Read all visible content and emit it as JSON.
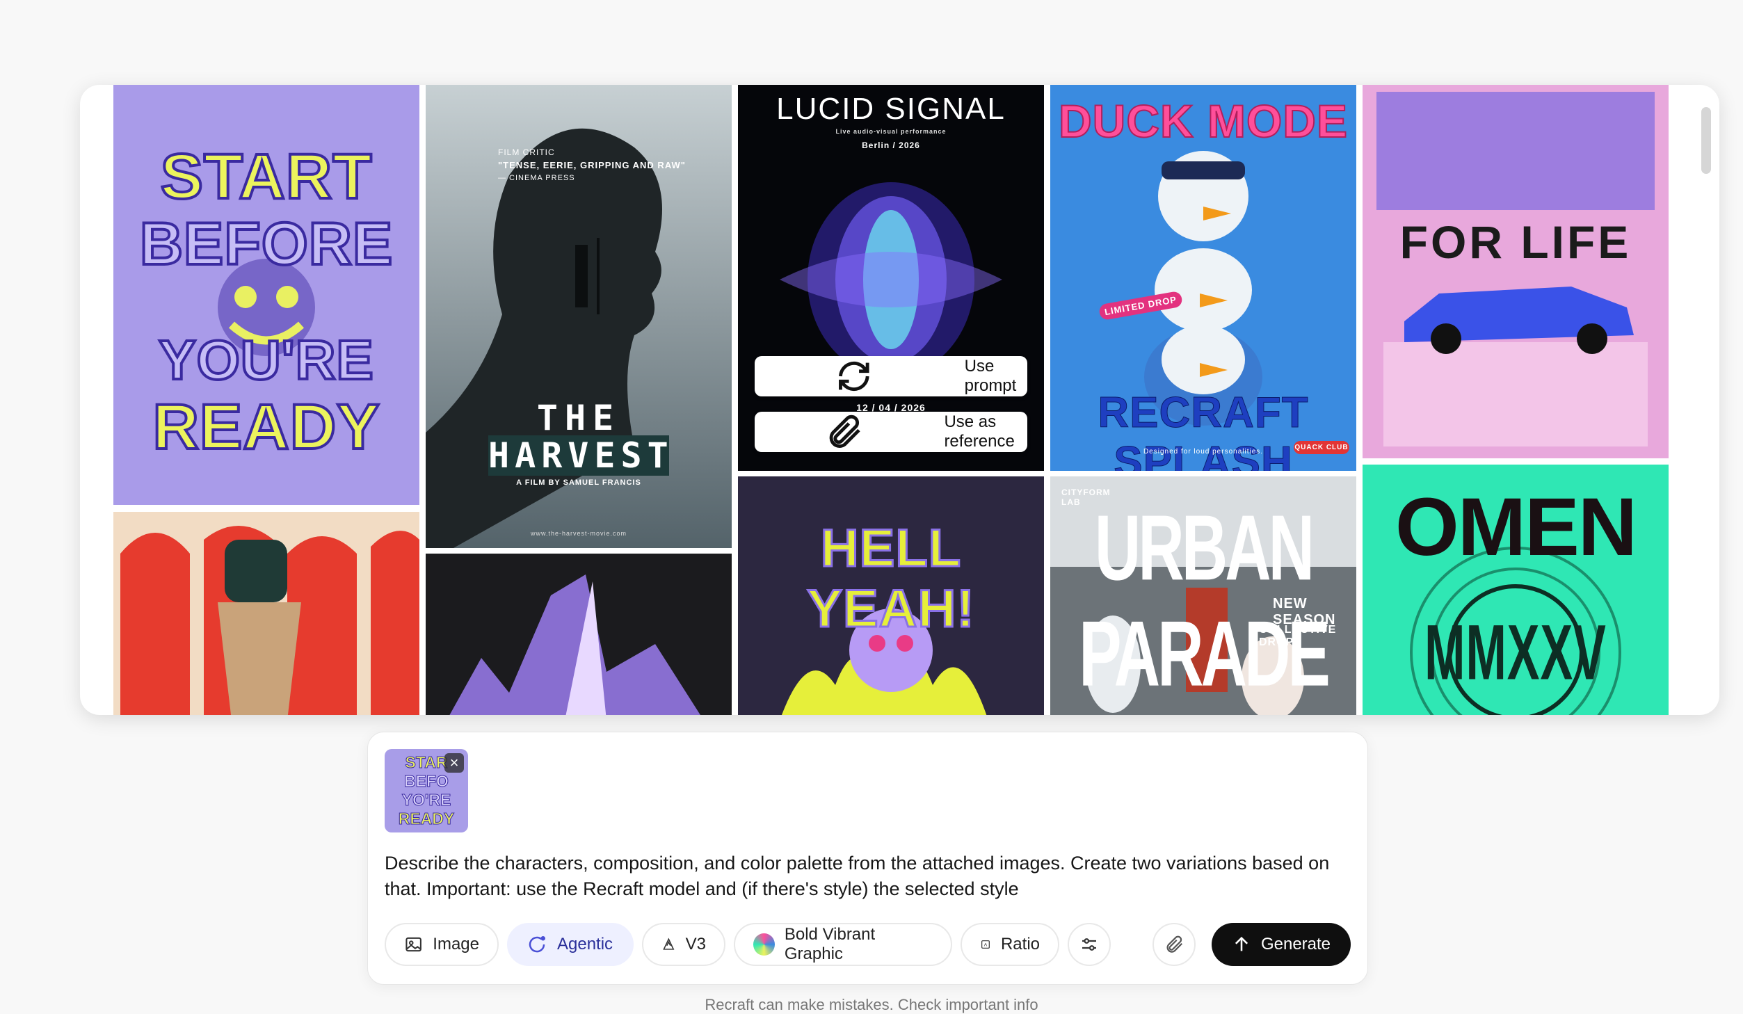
{
  "overlay": {
    "use_prompt": "Use prompt",
    "use_as_reference": "Use as reference"
  },
  "tiles": {
    "start": {
      "lines": [
        "START",
        "BEFORE",
        "YOU'RE",
        "READY"
      ]
    },
    "harvest": {
      "critic_label": "FILM CRITIC",
      "quote": "\"TENSE, EERIE, GRIPPING AND RAW\"",
      "quote_source": "— CINEMA PRESS",
      "title_1": "THE",
      "title_2": "HARVEST",
      "byline": "A FILM BY SAMUEL FRANCIS",
      "url": "www.the-harvest-movie.com"
    },
    "lucid": {
      "title": "LUCID SIGNAL",
      "subtitle": "Live audio-visual performance",
      "city": "Berlin / 2026",
      "date": "12 / 04 / 2026"
    },
    "duck": {
      "title": "DUCK MODE",
      "badge": "LIMITED DROP",
      "bottom": "RECRAFT SPLASH",
      "tagline": "Designed for loud personalities.",
      "club": "QUACK CLUB"
    },
    "forlife": {
      "title": "FOR LIFE"
    },
    "hell": {
      "title": "HELL YEAH!"
    },
    "urban": {
      "label": "CITYFORM LAB",
      "title": "URBAN PARADE",
      "season": "NEW SEASON",
      "drop": "COLLECTIVE DROP"
    },
    "omen": {
      "title": "OMEN",
      "numeral": "MMXXV"
    }
  },
  "attachment": {
    "lines": [
      "STAR",
      "BEFO",
      "YO'RE",
      "READY"
    ]
  },
  "prompt": "Describe the characters, composition, and color palette from the attached images. Create two variations based on that. Important: use the Recraft model and (if there's style) the selected style",
  "toolbar": {
    "image": "Image",
    "agentic": "Agentic",
    "version": "V3",
    "style": "Bold Vibrant Graphic",
    "ratio": "Ratio",
    "generate": "Generate"
  },
  "disclaimer": "Recraft can make mistakes. Check important info",
  "colors": {
    "accent": "#2a2f9a",
    "generate_bg": "#0f0f0f"
  }
}
